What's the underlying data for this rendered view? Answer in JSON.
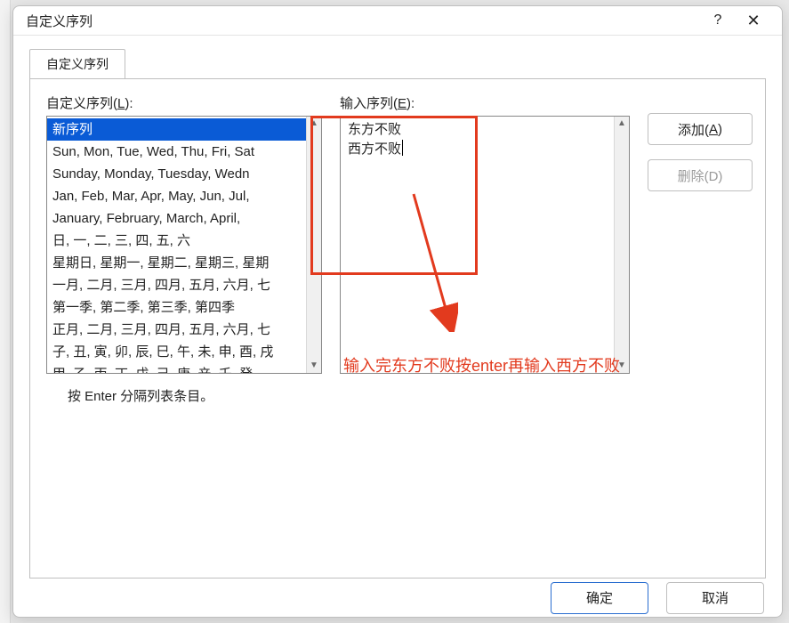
{
  "dialog_title": "自定义序列",
  "tab_label": "自定义序列",
  "left_label_pre": "自定义序列(",
  "left_label_accel": "L",
  "left_label_post": "):",
  "mid_label_pre": "输入序列(",
  "mid_label_accel": "E",
  "mid_label_post": "):",
  "list_items": [
    "新序列",
    "Sun, Mon, Tue, Wed, Thu, Fri, Sat",
    "Sunday, Monday, Tuesday, Wedn",
    "Jan, Feb, Mar, Apr, May, Jun, Jul, ",
    "January, February, March, April, ",
    "日, 一, 二, 三, 四, 五, 六",
    "星期日, 星期一, 星期二, 星期三, 星期",
    "一月, 二月, 三月, 四月, 五月, 六月, 七",
    "第一季, 第二季, 第三季, 第四季",
    "正月, 二月, 三月, 四月, 五月, 六月, 七",
    "子, 丑, 寅, 卯, 辰, 巳, 午, 未, 申, 酉, 戌",
    "甲, 乙, 丙, 丁, 戊, 己, 庚, 辛, 壬, 癸"
  ],
  "selected_index": 0,
  "entry_lines": [
    "东方不败",
    "西方不败"
  ],
  "btn_add_pre": "添加(",
  "btn_add_accel": "A",
  "btn_add_post": ")",
  "btn_delete": "删除(D)",
  "hint_text": "按 Enter 分隔列表条目。",
  "annotation_text": "输入完东方不败按enter再输入西方不败",
  "btn_ok": "确定",
  "btn_cancel": "取消",
  "help_symbol": "?",
  "close_symbol": "✕"
}
